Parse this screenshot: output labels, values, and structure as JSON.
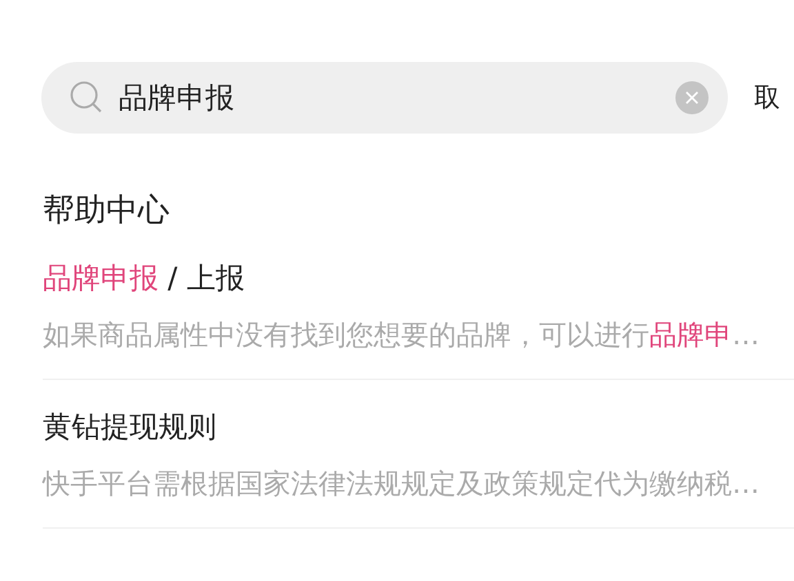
{
  "search": {
    "value": "品牌申报",
    "cancel": "取"
  },
  "section_title": "帮助中心",
  "results": [
    {
      "title": [
        {
          "text": "品牌申报",
          "highlight": true
        },
        {
          "text": " / 上报",
          "highlight": false
        }
      ],
      "snippet": [
        {
          "text": "如果商品属性中没有找到您想要的品牌，可以进行",
          "highlight": false
        },
        {
          "text": "品牌申",
          "highlight": true
        },
        {
          "text": "…",
          "highlight": false
        }
      ]
    },
    {
      "title": [
        {
          "text": "黄钻提现规则",
          "highlight": false
        }
      ],
      "snippet": [
        {
          "text": "快手平台需根据国家法律法规规定及政策规定代为缴纳税…",
          "highlight": false
        }
      ]
    }
  ]
}
